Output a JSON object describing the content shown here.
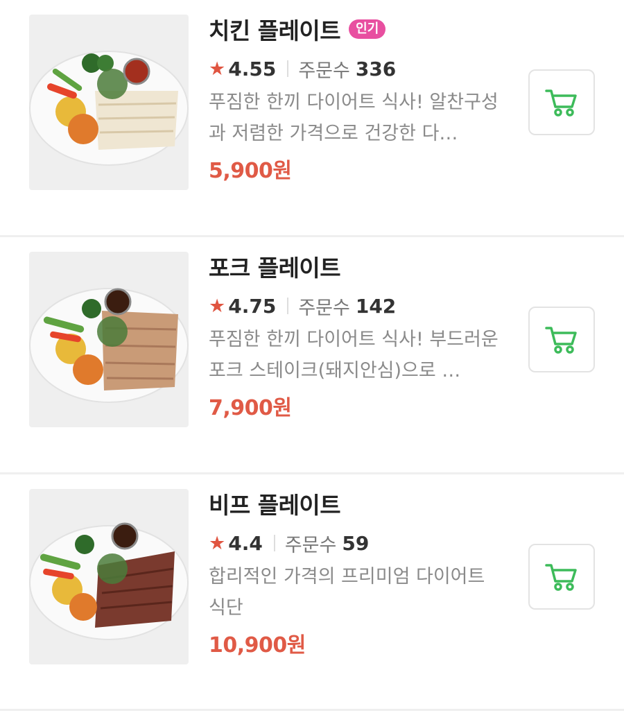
{
  "items": [
    {
      "name": "치킨 플레이트",
      "badge": "인기",
      "star": "★",
      "rating": "4.55",
      "orders_label": "주문수",
      "orders_count": "336",
      "description": "푸짐한 한끼 다이어트 식사! 알찬구성과 저렴한 가격으로 건강한 다…",
      "price": "5,900원",
      "protein_color": "#efe6d2"
    },
    {
      "name": "포크 플레이트",
      "badge": "",
      "star": "★",
      "rating": "4.75",
      "orders_label": "주문수",
      "orders_count": "142",
      "description": "푸짐한 한끼 다이어트 식사! 부드러운 포크 스테이크(돼지안심)으로 …",
      "price": "7,900원",
      "protein_color": "#c99b77"
    },
    {
      "name": "비프 플레이트",
      "badge": "",
      "star": "★",
      "rating": "4.4",
      "orders_label": "주문수",
      "orders_count": "59",
      "description": "합리적인 가격의 프리미엄 다이어트 식단",
      "price": "10,900원",
      "protein_color": "#7a3a2e"
    }
  ],
  "icons": {
    "cart": "cart-icon",
    "cart_color": "#3dbb5a"
  }
}
